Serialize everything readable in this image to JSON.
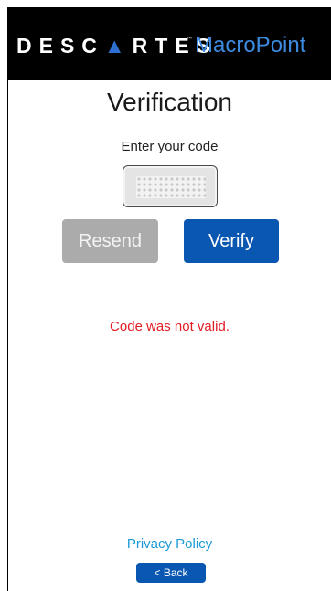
{
  "header": {
    "brand_left": "DESC",
    "brand_accent": "▲",
    "brand_right": "RTES",
    "brand_tm": "™",
    "brand_product": "MacroPoint"
  },
  "main": {
    "title": "Verification",
    "prompt": "Enter your code",
    "code_input_value": "",
    "resend_label": "Resend",
    "verify_label": "Verify",
    "error_message": "Code was not valid."
  },
  "footer": {
    "privacy_label": "Privacy Policy",
    "back_label": "< Back"
  },
  "colors": {
    "header_bg": "#000000",
    "brand_blue": "#3d8be0",
    "primary_button": "#0a57b2",
    "disabled_button": "#ababab",
    "error": "#e31b23",
    "link": "#1b9ad6"
  }
}
